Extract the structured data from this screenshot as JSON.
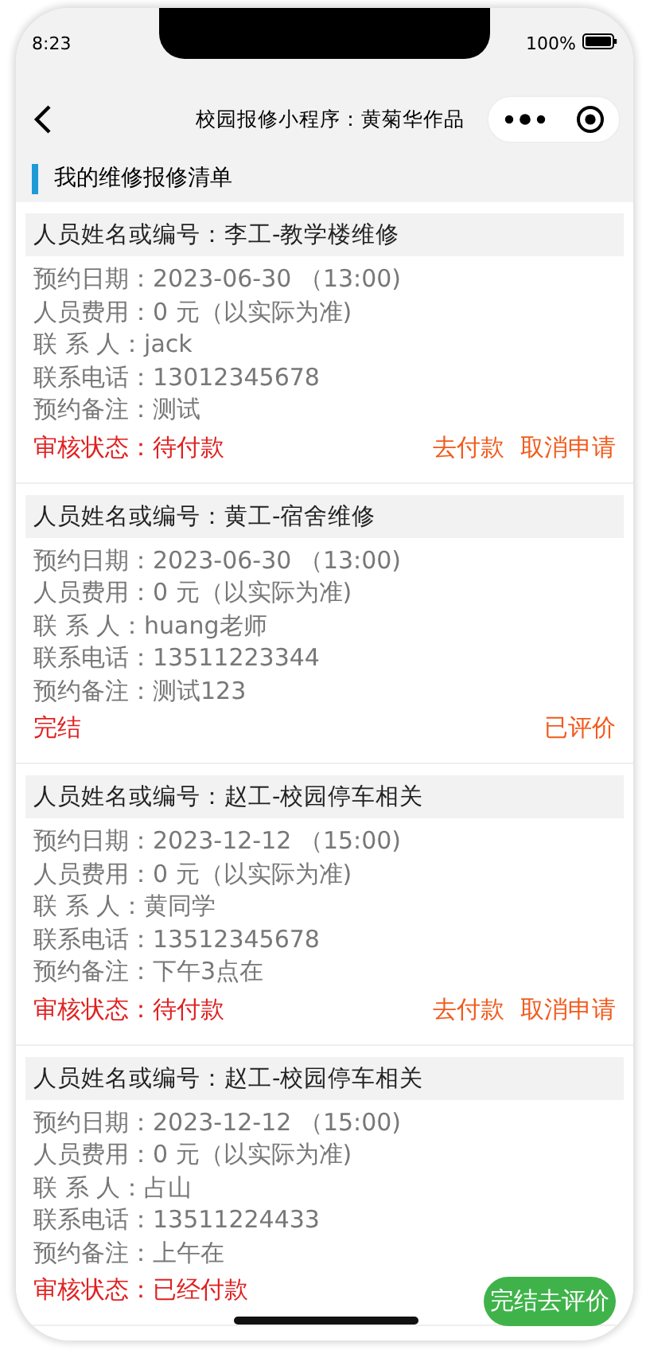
{
  "status_bar": {
    "time": "8:23",
    "battery": "100%"
  },
  "nav": {
    "title": "校园报修小程序：黄菊华作品"
  },
  "section": {
    "title": "我的维修报修清单"
  },
  "orders": [
    {
      "header": "人员姓名或编号：李工-教学楼维修",
      "lines": [
        "预约日期：2023-06-30 （13:00)",
        "人员费用：0 元（以实际为准)",
        "联 系 人：jack",
        "联系电话：13012345678",
        "预约备注：测试"
      ],
      "status": "审核状态：待付款",
      "actions": [
        {
          "label": "去付款",
          "kind": "link"
        },
        {
          "label": "取消申请",
          "kind": "link"
        }
      ]
    },
    {
      "header": "人员姓名或编号：黄工-宿舍维修",
      "lines": [
        "预约日期：2023-06-30 （13:00)",
        "人员费用：0 元（以实际为准)",
        "联 系 人：huang老师",
        "联系电话：13511223344",
        "预约备注：测试123"
      ],
      "status": "完结",
      "actions": [
        {
          "label": "已评价",
          "kind": "link"
        }
      ]
    },
    {
      "header": "人员姓名或编号：赵工-校园停车相关",
      "lines": [
        "预约日期：2023-12-12 （15:00)",
        "人员费用：0 元（以实际为准)",
        "联 系 人：黄同学",
        "联系电话：13512345678",
        "预约备注：下午3点在"
      ],
      "status": "审核状态：待付款",
      "actions": [
        {
          "label": "去付款",
          "kind": "link"
        },
        {
          "label": "取消申请",
          "kind": "link"
        }
      ]
    },
    {
      "header": "人员姓名或编号：赵工-校园停车相关",
      "lines": [
        "预约日期：2023-12-12 （15:00)",
        "人员费用：0 元（以实际为准)",
        "联 系 人：占山",
        "联系电话：13511224433",
        "预约备注：上午在"
      ],
      "status": "审核状态：已经付款",
      "actions": [
        {
          "label": "完结去评价",
          "kind": "button"
        }
      ]
    }
  ]
}
